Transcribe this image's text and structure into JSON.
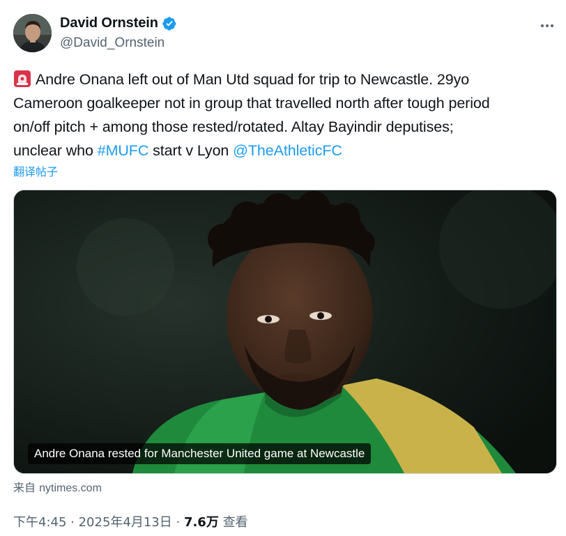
{
  "author": {
    "display_name": "David Ornstein",
    "handle": "@David_Ornstein",
    "verified": true
  },
  "tweet": {
    "line1": "Andre Onana left out of Man Utd squad for trip to Newcastle. 29yo",
    "line2": "Cameroon goalkeeper not in group that travelled north after tough period",
    "line3": "on/off pitch + among those rested/rotated. Altay Bayindir deputises;",
    "line4_start": "unclear who ",
    "hashtag": "#MUFC",
    "line4_mid": " start v Lyon ",
    "mention": "@TheAthleticFC",
    "translate_label": "翻译帖子"
  },
  "media": {
    "caption": "Andre Onana rested for Manchester United game at Newcastle",
    "source_prefix": "来自",
    "source_domain": "nytimes.com"
  },
  "meta": {
    "time": "下午4:45",
    "date": "2025年4月13日",
    "separator": " · ",
    "views_count": "7.6万",
    "views_label": "查看"
  },
  "colors": {
    "accent": "#1d9bf0",
    "text": "#0f1419",
    "secondary": "#536471",
    "verified_badge": "#1d9bf0"
  },
  "icons": {
    "verified": "verified-badge-icon",
    "siren": "rotating-light-emoji",
    "more": "more-options-icon"
  }
}
